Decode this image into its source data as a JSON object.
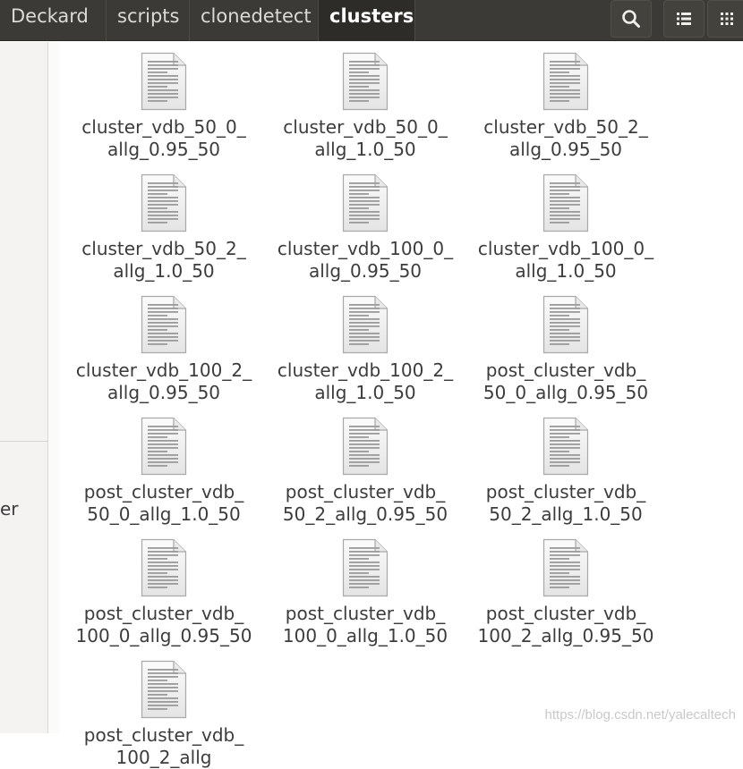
{
  "breadcrumbs": [
    {
      "label": "Deckard",
      "active": false
    },
    {
      "label": "scripts",
      "active": false
    },
    {
      "label": "clonedetect",
      "active": false
    },
    {
      "label": "clusters",
      "active": true
    }
  ],
  "toolbar": {
    "search_icon": "search-icon",
    "view_list_icon": "list-view-icon",
    "view_grid_icon": "grid-view-icon"
  },
  "sidebar": {
    "partial_label": "er"
  },
  "files": [
    {
      "line1": "cluster_vdb_50_0_",
      "line2": "allg_0.95_50"
    },
    {
      "line1": "cluster_vdb_50_0_",
      "line2": "allg_1.0_50"
    },
    {
      "line1": "cluster_vdb_50_2_",
      "line2": "allg_0.95_50"
    },
    {
      "line1": "cluster_vdb_50_2_",
      "line2": "allg_1.0_50"
    },
    {
      "line1": "cluster_vdb_100_0_",
      "line2": "allg_0.95_50"
    },
    {
      "line1": "cluster_vdb_100_0_",
      "line2": "allg_1.0_50"
    },
    {
      "line1": "cluster_vdb_100_2_",
      "line2": "allg_0.95_50"
    },
    {
      "line1": "cluster_vdb_100_2_",
      "line2": "allg_1.0_50"
    },
    {
      "line1": "post_cluster_vdb_",
      "line2": "50_0_allg_0.95_50"
    },
    {
      "line1": "post_cluster_vdb_",
      "line2": "50_0_allg_1.0_50"
    },
    {
      "line1": "post_cluster_vdb_",
      "line2": "50_2_allg_0.95_50"
    },
    {
      "line1": "post_cluster_vdb_",
      "line2": "50_2_allg_1.0_50"
    },
    {
      "line1": "post_cluster_vdb_",
      "line2": "100_0_allg_0.95_50"
    },
    {
      "line1": "post_cluster_vdb_",
      "line2": "100_0_allg_1.0_50"
    },
    {
      "line1": "post_cluster_vdb_",
      "line2": "100_2_allg_0.95_50"
    },
    {
      "line1": "post_cluster_vdb_",
      "line2": "100_2_allg"
    }
  ],
  "watermark": "https://blog.csdn.net/yalecaltech",
  "colors": {
    "header_bg": "#3b3a36",
    "active_crumb_bg": "#2d2c29",
    "text": "#3c3c3c"
  }
}
